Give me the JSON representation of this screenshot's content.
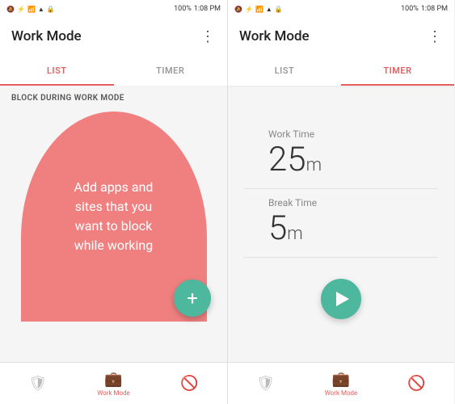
{
  "left": {
    "statusBar": {
      "left": [
        "🔕",
        "⚡",
        "📶",
        "📶",
        "🔒"
      ],
      "time": "1:08 PM",
      "right": [
        "100%"
      ]
    },
    "title": "Work Mode",
    "menu": "⋮",
    "tabs": [
      {
        "label": "LIST",
        "active": true
      },
      {
        "label": "TIMER",
        "active": false
      }
    ],
    "sectionLabel": "BLOCK DURING WORK MODE",
    "blobText": "Add apps and\nsites that you\nwant to block\nwhile working",
    "fab": "+",
    "bottomNav": [
      {
        "icon": "🛡",
        "label": "",
        "active": false
      },
      {
        "icon": "💼",
        "label": "Work Mode",
        "active": true
      },
      {
        "icon": "🚫",
        "label": "",
        "active": false
      }
    ]
  },
  "right": {
    "statusBar": {
      "left": [
        "🔕",
        "⚡",
        "📶",
        "📶",
        "🔒"
      ],
      "time": "1:08 PM",
      "right": [
        "100%"
      ]
    },
    "title": "Work Mode",
    "menu": "⋮",
    "tabs": [
      {
        "label": "LIST",
        "active": false
      },
      {
        "label": "TIMER",
        "active": true
      }
    ],
    "workTime": {
      "label": "Work Time",
      "value": "25",
      "unit": "m"
    },
    "breakTime": {
      "label": "Break Time",
      "value": "5",
      "unit": "m"
    },
    "bottomNav": [
      {
        "icon": "🛡",
        "label": "",
        "active": false
      },
      {
        "icon": "💼",
        "label": "Work Mode",
        "active": true
      },
      {
        "icon": "🚫",
        "label": "",
        "active": false
      }
    ]
  }
}
